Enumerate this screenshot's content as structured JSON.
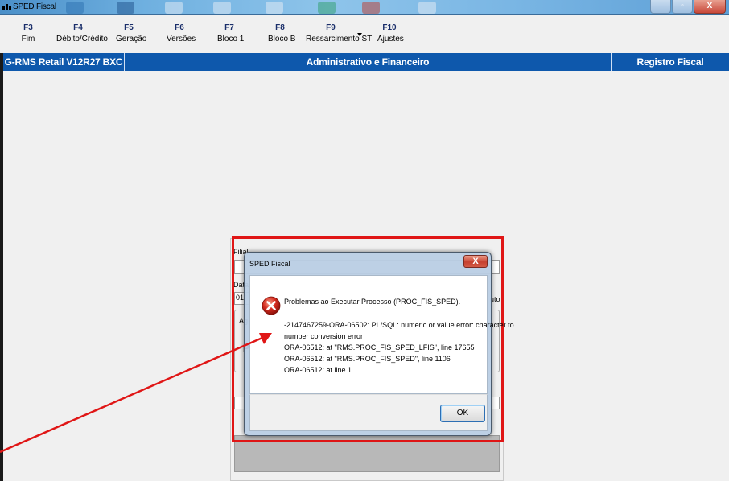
{
  "window": {
    "title": "SPED Fiscal",
    "close_glyph": "X",
    "minimize_glyph": "–",
    "restore_glyph": "▫"
  },
  "toolbar": {
    "keys": [
      {
        "key": "F3",
        "label": "Fim"
      },
      {
        "key": "F4",
        "label": "Débito/Crédito"
      },
      {
        "key": "F5",
        "label": "Geração"
      },
      {
        "key": "F6",
        "label": "Versões"
      },
      {
        "key": "F7",
        "label": "Bloco 1"
      },
      {
        "key": "F8",
        "label": "Bloco B"
      },
      {
        "key": "F9",
        "label": "Ressarcimento ST"
      },
      {
        "key": "F10",
        "label": "Ajustes"
      }
    ]
  },
  "statusbar": {
    "system": "G-RMS Retail V12R27 BXC",
    "module": "Administrativo e Financeiro",
    "area": "Registro Fiscal"
  },
  "form": {
    "filial_label": "Filial",
    "data_label": "Data",
    "data_value": "01/",
    "ag_label": "Ag",
    "p_label": "P",
    "uto_label": "uto"
  },
  "dialog": {
    "title": "SPED Fiscal",
    "close_label": "X",
    "message_title": "Problemas ao Executar Processo (PROC_FIS_SPED).",
    "lines": [
      "-2147467259-ORA-06502: PL/SQL: numeric or value error: character to",
      "number conversion error",
      "ORA-06512: at \"RMS.PROC_FIS_SPED_LFIS\", line 17655",
      "ORA-06512: at \"RMS.PROC_FIS_SPED\", line 1106",
      "ORA-06512: at line 1"
    ],
    "ok_label": "OK"
  },
  "colors": {
    "statusbar": "#0e58ac",
    "highlight": "#e01616",
    "error_icon": "#d42a1e"
  },
  "icons": [
    "app-icon",
    "error-icon",
    "close-icon",
    "minimize-icon",
    "restore-icon",
    "dropdown-arrow-icon"
  ]
}
